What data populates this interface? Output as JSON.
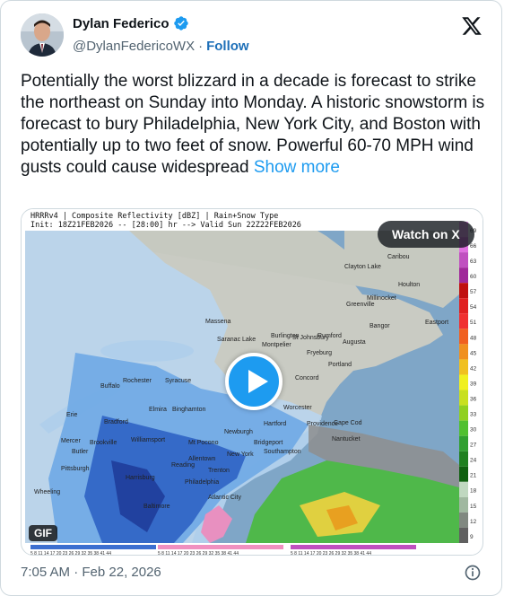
{
  "author": {
    "display_name": "Dylan Federico",
    "handle": "@DylanFedericoWX",
    "follow_label": "Follow",
    "verified_color": "#1d9bf0"
  },
  "tweet": {
    "text": "Potentially the worst blizzard in a decade is forecast to strike the northeast on Sunday into Monday. A historic snowstorm is forecast to bury Philadelphia, New York City, and Boston with potentially up to two feet of snow. Powerful 60-70 MPH wind gusts could cause widespread",
    "show_more_label": "Show more",
    "timestamp": "7:05 AM · Feb 22, 2026"
  },
  "media": {
    "map_title": "HRRRv4 | Composite Reflectivity [dBZ] | Rain+Snow Type",
    "map_init": "Init: 18Z21FEB2026 -- [28:00] hr --> Valid Sun 22Z22FEB2026",
    "watch_label": "Watch on X",
    "gif_label": "GIF",
    "scale_values": [
      "69",
      "66",
      "63",
      "60",
      "57",
      "54",
      "51",
      "48",
      "45",
      "42",
      "39",
      "36",
      "33",
      "30",
      "27",
      "24",
      "21",
      "18",
      "15",
      "12",
      "9"
    ],
    "scale_colors": [
      "#f0a0f0",
      "#e070e0",
      "#c050c0",
      "#a0289a",
      "#c01010",
      "#e02020",
      "#f03030",
      "#f06020",
      "#f09020",
      "#f0c020",
      "#f0f020",
      "#c8e020",
      "#90d020",
      "#50c030",
      "#30a030",
      "#208020",
      "#106010",
      "#c0d8c0",
      "#a0b8a0",
      "#808880",
      "#606060"
    ],
    "cities": [
      "Caribou",
      "Clayton Lake",
      "Houlton",
      "Millinocket",
      "Greenville",
      "Bangor",
      "Eastport",
      "Massena",
      "Burlington",
      "Saranac Lake",
      "St Johnsbury",
      "Montpelier",
      "Rumford",
      "Augusta",
      "Fryeburg",
      "Portland",
      "Rochester",
      "Buffalo",
      "Syracuse",
      "Concord",
      "Erie",
      "Elmira",
      "Binghamton",
      "Worcester",
      "Hartford",
      "Providence",
      "Cape Cod",
      "Bradford",
      "Newburgh",
      "Nantucket",
      "Mercer",
      "Brookville",
      "Williamsport",
      "Mt Pocono",
      "Bridgeport",
      "Butler",
      "New York",
      "Southampton",
      "Allentown",
      "Pittsburgh",
      "Reading",
      "Trenton",
      "Philadelphia",
      "Atlantic City",
      "Harrisburg",
      "Baltimore",
      "Wheeling"
    ],
    "colors": {
      "land": "#c9cbc3",
      "ocean": "#7fa6c7",
      "snow_light": "#b9d6f1",
      "snow_medium": "#6fa9e6",
      "snow_heavy": "#2f63c4",
      "rain_light": "#4fb84a",
      "rain_heavy": "#e0d040"
    }
  }
}
